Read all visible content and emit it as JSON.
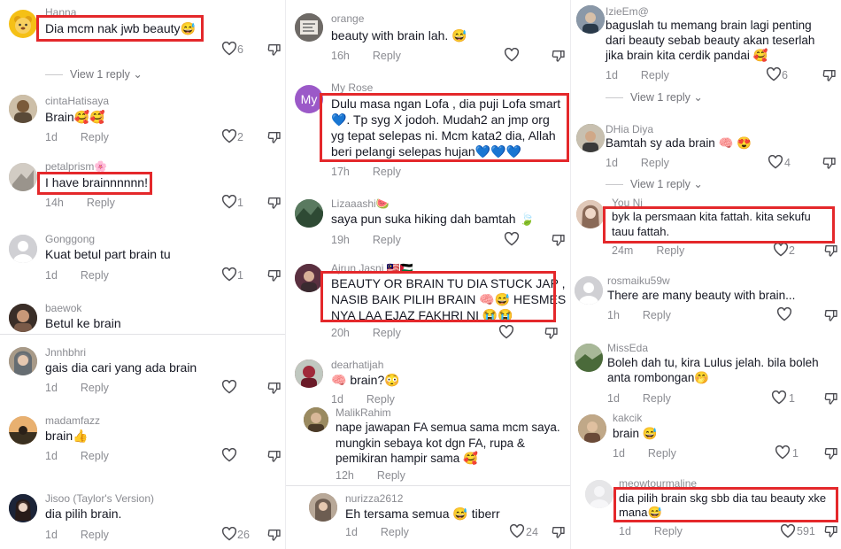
{
  "col1": {
    "comments": [
      {
        "user": "Hanna",
        "text": "Dia mcm nak jwb beauty😅",
        "likes": "6",
        "avatar_color": "#f5c016"
      },
      {
        "view_replies": "View 1 reply"
      },
      {
        "user": "cintaHatisaya",
        "text": "Brain🥰🥰",
        "time": "1d",
        "reply": "Reply",
        "likes": "2",
        "avatar_color": "#a58d6c"
      },
      {
        "user": "petalprism🌸",
        "text": "I have brainnnnnn!",
        "time": "14h",
        "reply": "Reply",
        "likes": "1",
        "avatar_color": "#b8b1a8"
      },
      {
        "user": "Gonggong",
        "text": "Kuat betul part brain tu",
        "time": "1d",
        "reply": "Reply",
        "likes": "1",
        "avatar_color": "#c8c8cc"
      },
      {
        "user": "baewok",
        "text": "Betul ke brain",
        "avatar_color": "#5b4638"
      },
      {
        "user": "Jnnhbhri",
        "text": "gais dia cari yang ada brain",
        "time": "1d",
        "reply": "Reply",
        "avatar_color": "#8a7a6a"
      },
      {
        "user": "madamfazz",
        "text": "brain👍",
        "time": "1d",
        "reply": "Reply",
        "avatar_color": "#c9a070"
      },
      {
        "user": "Jisoo (Taylor's Version)",
        "text": "dia pilih brain.",
        "time": "1d",
        "reply": "Reply",
        "likes": "26",
        "avatar_color": "#243048"
      }
    ]
  },
  "col2": {
    "comments": [
      {
        "user": "orange",
        "text": "beauty with brain lah. 😅",
        "time": "16h",
        "reply": "Reply",
        "avatar_color": "#7a7570"
      },
      {
        "user": "My Rose",
        "avatar_letter": "My",
        "lines": [
          "Dulu masa ngan Lofa , dia puji Lofa smart",
          "💙. Tp syg X jodoh. Mudah2 an jmp org",
          "yg tepat selepas ni. Mcm kata2 dia, Allah",
          "beri pelangi selepas hujan💙💙💙"
        ],
        "time": "17h",
        "reply": "Reply",
        "avatar_color": "#9b59c8"
      },
      {
        "user": "Lizaaashi🍉",
        "text": "saya pun suka hiking dah bamtah 🍃",
        "time": "19h",
        "reply": "Reply",
        "avatar_color": "#4a6a50"
      },
      {
        "user": "Ajrun Jasni 🇲🇾🇵🇸",
        "lines": [
          "BEAUTY OR BRAIN TU DIA STUCK JAP ,",
          "NASIB BAIK PILIH BRAIN 🧠😅 HESMES",
          "NYA LAA EJAZ FAKHRI NI 😭😭"
        ],
        "time": "20h",
        "reply": "Reply",
        "avatar_color": "#7a3a4a"
      },
      {
        "user": "dearhatijah",
        "text": "🧠 brain?😳",
        "time": "1d",
        "reply": "Reply",
        "avatar_color": "#8a2a3a"
      },
      {
        "user": "MalikRahim",
        "lines": [
          "nape jawapan FA semua sama mcm saya.",
          "mungkin sebaya kot dgn FA, rupa &",
          "pemikiran hampir sama 🥰"
        ],
        "time": "12h",
        "reply": "Reply",
        "avatar_color": "#6a5a40"
      },
      {
        "user": "nurizza2612",
        "text": "Eh tersama semua 😅 tiberr",
        "time": "1d",
        "reply": "Reply",
        "likes": "24",
        "avatar_color": "#8a6a5a"
      }
    ]
  },
  "col3": {
    "comments": [
      {
        "user": "IzieEm@",
        "lines": [
          "baguslah tu memang brain lagi penting",
          "dari beauty sebab beauty akan teserlah",
          "jika brain kita cerdik pandai 🥰"
        ],
        "time": "1d",
        "reply": "Reply",
        "likes": "6",
        "avatar_color": "#3a4a5a"
      },
      {
        "view_replies": "View 1 reply"
      },
      {
        "user": "DHia Diya",
        "text": "Bamtah sy ada brain 🧠 😍",
        "time": "1d",
        "reply": "Reply",
        "likes": "4",
        "avatar_color": "#5a6a4a"
      },
      {
        "view_replies": "View 1 reply"
      },
      {
        "user": "You Ni",
        "lines": [
          "byk la persmaan kita fattah. kita sekufu",
          "tauu fattah."
        ],
        "time": "24m",
        "reply": "Reply",
        "likes": "2",
        "avatar_color": "#c89a78"
      },
      {
        "user": "rosmaiku59w",
        "text": "There are many beauty with brain...",
        "time": "1h",
        "reply": "Reply",
        "avatar_color": "#c8c8cc"
      },
      {
        "user": "MissEda",
        "lines": [
          "Boleh dah tu, kira Lulus jelah. bila boleh",
          "anta rombongan🤭"
        ],
        "time": "1d",
        "reply": "Reply",
        "likes": "1",
        "avatar_color": "#6a7a5a"
      },
      {
        "user": "kakcik",
        "text": "brain 😅",
        "time": "1d",
        "reply": "Reply",
        "likes": "1",
        "avatar_color": "#8a6a50"
      },
      {
        "user": "meowtourmaline_",
        "lines": [
          "dia pilih brain skg sbb dia tau beauty xke",
          "mana😅"
        ],
        "time": "1d",
        "reply": "Reply",
        "likes": "591",
        "avatar_color": "#d8d8da"
      }
    ]
  },
  "colors": {
    "highlight": "#e4282b",
    "username": "#8a8b91",
    "text": "#161823"
  }
}
